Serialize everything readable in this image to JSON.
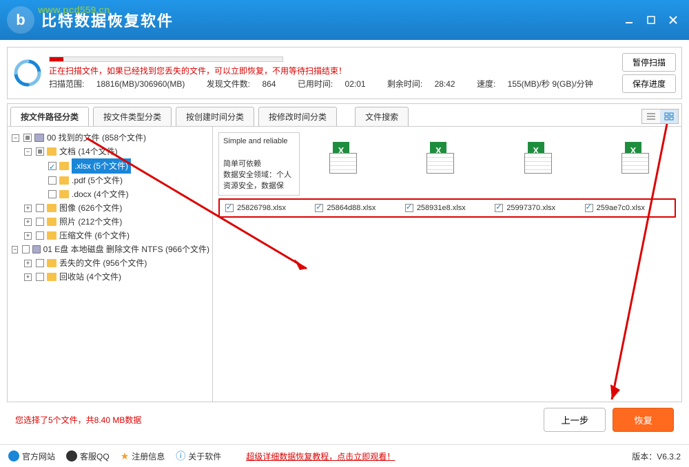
{
  "app": {
    "title": "比特数据恢复软件",
    "watermark": "www.pcd559.cn"
  },
  "window_controls": {
    "min": "minimize",
    "max": "maximize",
    "close": "close"
  },
  "status": {
    "scanning_msg": "正在扫描文件，如果已经找到您丢失的文件，可以立即恢复，不用等待扫描结束！",
    "scope_label": "扫描范围:",
    "scope_value": "18816(MB)/306960(MB)",
    "found_label": "发现文件数:",
    "found_value": "864",
    "elapsed_label": "已用时间:",
    "elapsed_value": "02:01",
    "remain_label": "剩余时间:",
    "remain_value": "28:42",
    "speed_label": "速度:",
    "speed_value": "155(MB)/秒  9(GB)/分钟",
    "pause": "暂停扫描",
    "save": "保存进度",
    "progress_pct": 6
  },
  "tabs": {
    "path": "按文件路径分类",
    "type": "按文件类型分类",
    "ctime": "按创建时间分类",
    "mtime": "按修改时间分类",
    "search": "文件搜索"
  },
  "tree": {
    "root1": "00 找到的文件  (858个文件)",
    "docs": "文档    (14个文件)",
    "xlsx": ".xlsx    (5个文件)",
    "pdf": ".pdf    (5个文件)",
    "docx": ".docx    (4个文件)",
    "images": "图像    (626个文件)",
    "photos": "照片    (212个文件)",
    "archives": "压缩文件    (6个文件)",
    "root2": "01 E盘  本地磁盘  删除文件 NTFS  (966个文件)",
    "lost": "丢失的文件     (956个文件)",
    "recycle": "回收站    (4个文件)"
  },
  "preview": {
    "title": "Simple and reliable",
    "body": "简单可依赖\n数据安全领域：个人资源安全，数据保"
  },
  "files": [
    "25826798.xlsx",
    "25864d88.xlsx",
    "258931e8.xlsx",
    "25997370.xlsx",
    "259ae7c0.xlsx"
  ],
  "selection": {
    "info": "您选择了5个文件，共8.40 MB数据"
  },
  "buttons": {
    "prev": "上一步",
    "recover": "恢复"
  },
  "footer": {
    "site": "官方网站",
    "qq": "客服QQ",
    "register": "注册信息",
    "about": "关于软件",
    "tutorial": "超级详细数据恢复教程，点击立即观看！",
    "version_label": "版本：",
    "version": "V6.3.2"
  }
}
